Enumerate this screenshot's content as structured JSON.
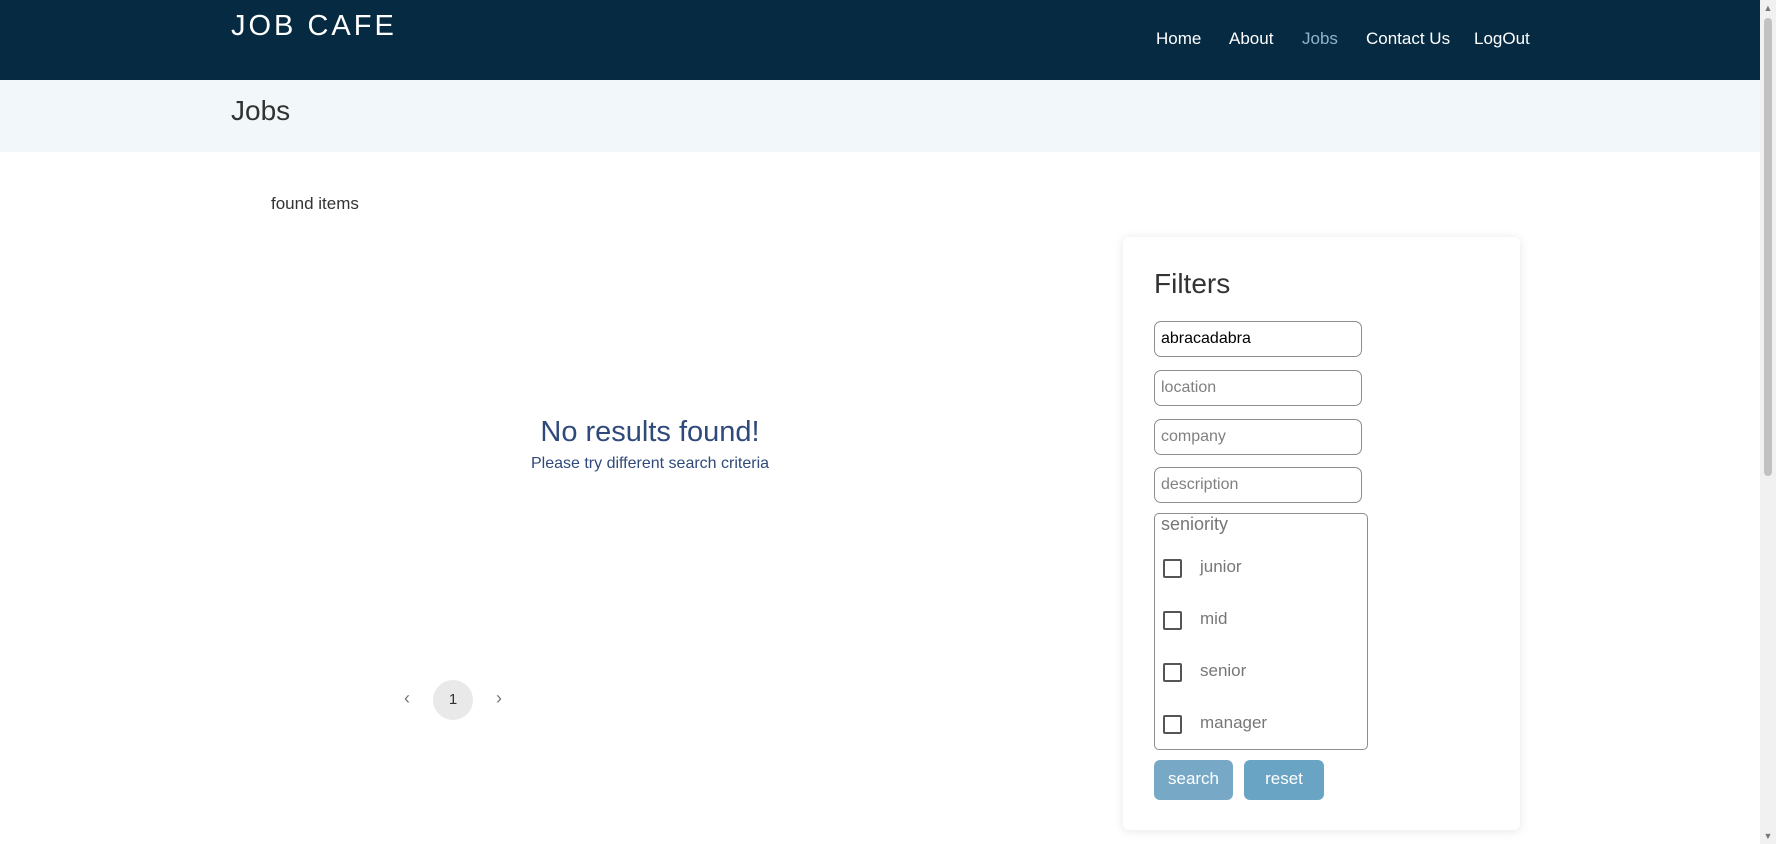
{
  "header": {
    "brand": "JOB CAFE",
    "nav": [
      {
        "label": "Home",
        "active": false
      },
      {
        "label": "About",
        "active": false
      },
      {
        "label": "Jobs",
        "active": true
      },
      {
        "label": "Contact Us",
        "active": false
      },
      {
        "label": "LogOut",
        "active": false
      }
    ]
  },
  "page": {
    "title": "Jobs"
  },
  "results": {
    "found_label": "found items",
    "empty_title": "No results found!",
    "empty_subtitle": "Please try different search criteria"
  },
  "pagination": {
    "prev_icon": "‹",
    "current_page": "1",
    "next_icon": "›"
  },
  "filters": {
    "title": "Filters",
    "search": {
      "value": "abracadabra",
      "placeholder": ""
    },
    "location": {
      "value": "",
      "placeholder": "location"
    },
    "company": {
      "value": "",
      "placeholder": "company"
    },
    "description": {
      "value": "",
      "placeholder": "description"
    },
    "seniority": {
      "legend": "seniority",
      "options": [
        {
          "label": "junior",
          "checked": false
        },
        {
          "label": "mid",
          "checked": false
        },
        {
          "label": "senior",
          "checked": false
        },
        {
          "label": "manager",
          "checked": false
        }
      ]
    },
    "search_button": "search",
    "reset_button": "reset"
  },
  "colors": {
    "header_bg": "#052a41",
    "nav_active": "#8fb3cc",
    "titlebar_bg": "#f2f7fa",
    "empty_text": "#2f4a7a",
    "button_bg": "#77a9c6"
  }
}
